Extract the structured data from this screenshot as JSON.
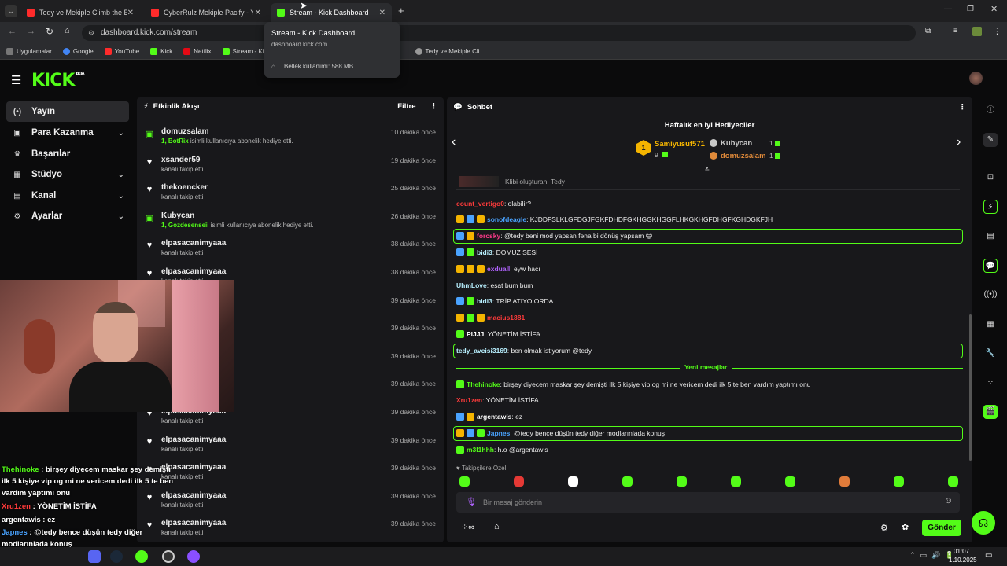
{
  "browser": {
    "tabs": [
      {
        "title": "Tedy ve Mekiple Climb the Back",
        "color": "#ff2b2b"
      },
      {
        "title": "CyberRulz Mekiple Pacify - You",
        "color": "#ff2b2b"
      },
      {
        "title": "Stream - Kick Dashboard",
        "color": "#53fc18"
      }
    ],
    "url": "dashboard.kick.com/stream",
    "bookmarks": [
      "Uygulamalar",
      "Google",
      "YouTube",
      "Kick",
      "Netflix",
      "Stream - Kick",
      "Tedy ve Mekiple Cli..."
    ],
    "tooltip": {
      "title": "Stream - Kick Dashboard",
      "domain": "dashboard.kick.com",
      "memory": "Bellek kullanımı: 588 MB"
    }
  },
  "app": {
    "logo": "KICK",
    "beta": "BETA"
  },
  "sidebar": {
    "items": [
      {
        "label": "Yayın",
        "icon": "broadcast-icon",
        "glyph": "(•)"
      },
      {
        "label": "Para Kazanma",
        "icon": "wallet-icon",
        "glyph": "▣",
        "chev": "⌄"
      },
      {
        "label": "Başarılar",
        "icon": "trophy-icon",
        "glyph": "🏆"
      },
      {
        "label": "Stüdyo",
        "icon": "studio-icon",
        "glyph": "▦",
        "chev": "⌄"
      },
      {
        "label": "Kanal",
        "icon": "channel-icon",
        "glyph": "▤",
        "chev": "⌄"
      },
      {
        "label": "Ayarlar",
        "icon": "gear-icon",
        "glyph": "⚙",
        "chev": "⌄"
      }
    ]
  },
  "activity": {
    "title": "Etkinlik Akışı",
    "filter": "Filtre",
    "rows": [
      {
        "name": "domuzsalam",
        "sub_bold": "1, BotRix",
        "sub": " isimli kullanıcıya abonelik hediye etti.",
        "time": "10 dakika önce",
        "type": "gift"
      },
      {
        "name": "xsander59",
        "sub": "kanalı takip etti",
        "time": "19 dakika önce",
        "type": "follow"
      },
      {
        "name": "thekoencker",
        "sub": "kanalı takip etti",
        "time": "25 dakika önce",
        "type": "follow"
      },
      {
        "name": "Kubycan",
        "sub_bold": "1, Gozdesenseii",
        "sub": " isimli kullanıcıya abonelik hediye etti.",
        "time": "26 dakika önce",
        "type": "gift"
      },
      {
        "name": "elpasacanimyaaa",
        "sub": "kanalı takip etti",
        "time": "38 dakika önce",
        "type": "follow"
      },
      {
        "name": "elpasacanimyaaa",
        "sub": "kanalı takip etti",
        "time": "38 dakika önce",
        "type": "follow"
      },
      {
        "name": "elpasacanimyaaa",
        "sub": "kanalı takip etti",
        "time": "39 dakika önce",
        "type": "follow"
      },
      {
        "name": "elpasacanimyaaa",
        "sub": "kanalı takip etti",
        "time": "39 dakika önce",
        "type": "follow"
      },
      {
        "name": "elpasacanimyaaa",
        "sub": "kanalı takip etti",
        "time": "39 dakika önce",
        "type": "follow"
      },
      {
        "name": "elpasacanimyaaa",
        "sub": "kanalı takip etti",
        "time": "39 dakika önce",
        "type": "follow"
      },
      {
        "name": "elpasacanimyaaa",
        "sub": "kanalı takip etti",
        "time": "39 dakika önce",
        "type": "follow"
      },
      {
        "name": "elpasacanimyaaa",
        "sub": "kanalı takip etti",
        "time": "39 dakika önce",
        "type": "follow"
      },
      {
        "name": "elpasacanimyaaa",
        "sub": "kanalı takip etti",
        "time": "39 dakika önce",
        "type": "follow"
      },
      {
        "name": "elpasacanimyaaa",
        "sub": "kanalı takip etti",
        "time": "39 dakika önce",
        "type": "follow"
      },
      {
        "name": "elpasacanimyaaa",
        "sub": "kanalı takip etti",
        "time": "39 dakika önce",
        "type": "follow"
      }
    ]
  },
  "overlay_chat": [
    {
      "user": "Thehinoke",
      "color": "#53fc18",
      "text": " : birşey diyecem maskar şey demiştı"
    },
    {
      "user": "",
      "color": "#fff",
      "text": "ilk 5 kişiye vip og mi ne vericem dedi ilk 5 te ben"
    },
    {
      "user": "",
      "color": "#fff",
      "text": "vardım yaptımı onu"
    },
    {
      "user": "Xru1zen",
      "color": "#ff3b3b",
      "text": " : YÖNETİM İSTİFA"
    },
    {
      "user": "argentawis",
      "color": "#fff",
      "text": " : ez"
    },
    {
      "user": "Japnes",
      "color": "#4aa3ff",
      "text": " : @tedy bence düşün tedy diğer"
    },
    {
      "user": "",
      "color": "#fff",
      "text": "modlarınlada konuş"
    },
    {
      "user": "m3l1hhh",
      "color": "#fff",
      "text": " h.o @argentawis"
    }
  ],
  "chat": {
    "title": "Sohbet",
    "gifters": {
      "title": "Haftalık en iyi Hediyeciler",
      "first": {
        "name": "Samiyusuf571",
        "count": "9"
      },
      "second": {
        "name": "Kubycan",
        "count": "1"
      },
      "third": {
        "name": "domuzsalam",
        "count": "1"
      }
    },
    "clip": "Klibi oluşturan: Tedy",
    "messages": [
      {
        "user": "count_vertigo0",
        "color": "#ff3b3b",
        "text": ": olabilir?",
        "hl": false
      },
      {
        "user": "sonofdeagle",
        "color": "#4aa3ff",
        "text": ": KJDDFSLKLGFDGJFGKFDHDFGKHGGKHGGFLHKGKHGFDHGFKGHDGKFJH",
        "hl": false
      },
      {
        "user": "forcsky",
        "color": "#ff3b8b",
        "text": ": @tedy beni mod yapsan fena bi dönüş yapsam 😄",
        "hl": true
      },
      {
        "user": "bidi3",
        "color": "#b8f0ff",
        "text": ": DOMUZ SESİ",
        "hl": false
      },
      {
        "user": "exduall",
        "color": "#b163ff",
        "text": ": eyw hacı",
        "hl": false
      },
      {
        "user": "UhmLove",
        "color": "#b8f0ff",
        "text": ": esat bum bum",
        "hl": false
      },
      {
        "user": "bidi3",
        "color": "#b8f0ff",
        "text": ": TRİP ATIYO ORDA",
        "hl": false
      },
      {
        "user": "macius1881",
        "color": "#ff3b3b",
        "text": ":",
        "hl": false
      },
      {
        "user": "PIJJJ",
        "color": "#ffffff",
        "text": ": YÖNETİM İSTİFA",
        "hl": false
      },
      {
        "user": "tedy_avcisi3169",
        "color": "#b8f0ff",
        "text": ": ben olmak istiyorum @tedy",
        "hl": true
      },
      {
        "user": "Thehinoke",
        "color": "#53fc18",
        "text": ": birşey diyecem maskar şey demişti ilk 5 kişiye vip og mi ne vericem dedi ilk 5 te ben vardım yaptımı onu",
        "hl": false
      },
      {
        "user": "Xru1zen",
        "color": "#ff3b3b",
        "text": ": YÖNETİM İSTİFA",
        "hl": false
      },
      {
        "user": "argentawis",
        "color": "#ffffff",
        "text": ": ez",
        "hl": false
      },
      {
        "user": "Japnes",
        "color": "#4aa3ff",
        "text": ": @tedy bence düşün tedy diğer modlarınlada konuş",
        "hl": true
      },
      {
        "user": "m3l1hhh",
        "color": "#53fc18",
        "text": ": h.o @argentawis",
        "hl": false
      }
    ],
    "new_messages": "Yeni mesajlar",
    "emote_title": "Takipçilere Özel",
    "input_placeholder": "Bir mesaj gönderin",
    "send": "Gönder"
  },
  "taskbar": {
    "time": "01:07",
    "date": "1.10.2025"
  },
  "colors": {
    "brand": "#53fc18",
    "panel": "#18181b",
    "bg": "#0b0b0c"
  }
}
